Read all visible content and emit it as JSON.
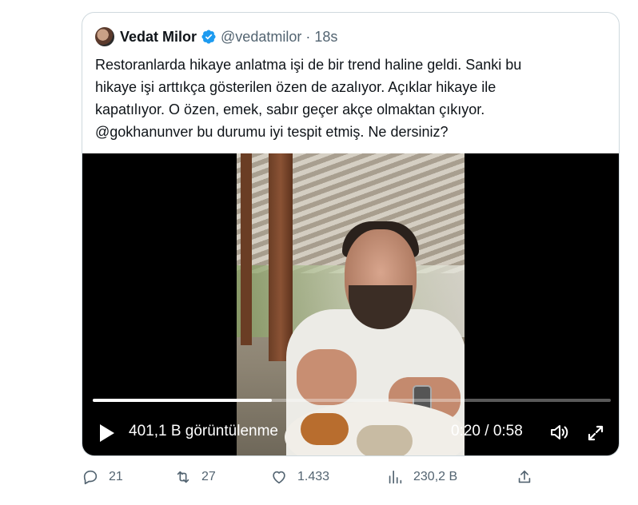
{
  "tweet": {
    "author_name": "Vedat Milor",
    "handle_time": "@vedatmilor · 18s",
    "text_lines": [
      "Restoranlarda hikaye anlatma işi de bir trend haline geldi. Sanki bu",
      "hikaye işi arttıkça gösterilen özen de azalıyor. Açıklar hikaye ile",
      "kapatılıyor. O özen, emek, sabır geçer akçe olmaktan çıkıyor.",
      "@gokhanunver bu durumu iyi tespit etmiş. Ne dersiniz?"
    ]
  },
  "video": {
    "views": "401,1 B görüntülenme",
    "time": "0:20 / 0:58",
    "progress": 0.345,
    "icons": [
      "play-icon",
      "volume-icon",
      "fullscreen-icon"
    ]
  },
  "actions": {
    "replies": "21",
    "reposts": "27",
    "likes": "1.433",
    "views": "230,2 B",
    "icons": [
      "reply-icon",
      "repost-icon",
      "like-icon",
      "analytics-icon",
      "share-icon"
    ]
  },
  "colors": {
    "verified": "#1d9bf0",
    "muted": "#536471",
    "border": "#cfd9de"
  }
}
